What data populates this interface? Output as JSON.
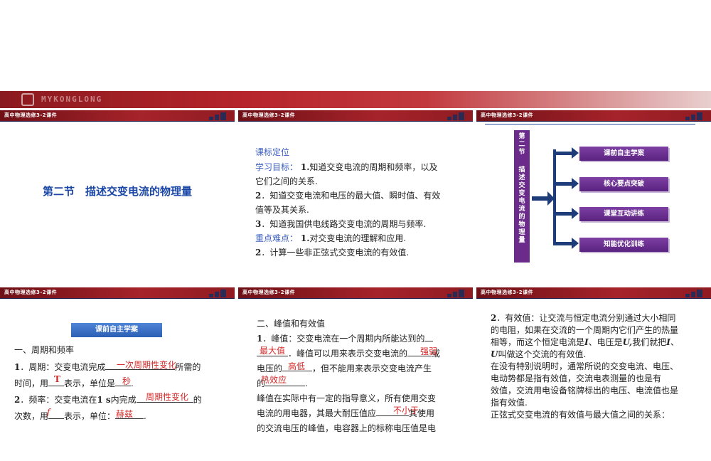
{
  "brand": "MYKONGLONG",
  "header": "高中物理选修3-2课件",
  "slide1": {
    "title": "第二节　描述交变电流的物理量"
  },
  "slide2": {
    "heading": "课标定位",
    "goal_label": "学习目标：",
    "g1a": "1.",
    "g1b": "知道交变电流的周期和频率，以及",
    "g1c": "它们之间的关系.",
    "g2a": "2",
    "g2b": "．知道交变电流和电压的最大值、瞬时值、有效",
    "g2c": "值等及其关系.",
    "g3a": "3",
    "g3b": "．知道我国供电线路交变电流的周期与频率.",
    "key_label": "重点难点：",
    "k1a": "1.",
    "k1b": "对交变电流的理解和应用.",
    "k2a": "2",
    "k2b": "．计算一些非正弦式交变电流的有效值."
  },
  "slide3": {
    "vertical_title": "第二节描述交变电流的物理量",
    "menu": [
      "课前自主学案",
      "核心要点突破",
      "课堂互动讲练",
      "知能优化训练"
    ]
  },
  "slide4": {
    "section": "课前自主学案",
    "h1": "一、周期和频率",
    "l1a": "1",
    "l1b": "．周期：交变电流完成",
    "l1fill": "一次周期性变化",
    "l1c": "所需的",
    "l2a": "时间，用",
    "l2fill": "T",
    "l2b": "表示，单位是",
    "l2fill2": "秒",
    "l2c": ".",
    "l3a": "2",
    "l3b": "．频率：交变电流在",
    "l3s": "1 s",
    "l3c": "内完成",
    "l3fill": "周期性变化",
    "l3d": "的",
    "l4a": "次数，用",
    "l4fill": "f",
    "l4b": "表示，单位：",
    "l4fill2": "赫兹",
    "l4c": "."
  },
  "slide5": {
    "h2": "二、峰值和有效值",
    "p1a": "1",
    "p1b": "．峰值：交变电流在一个周期内所能达到的",
    "p1fill": "最大值",
    "p1c": "．峰值可以用来表示交变电流的",
    "p1fill2": "强弱",
    "p1d": "或",
    "p2a": "电压的",
    "p2fill": "高低",
    "p2b": "，但不能用来表示交变电流产生",
    "p3a": "的",
    "p3fill": "热效应",
    "p3b": ".",
    "p4": "峰值在实际中有一定的指导意义，所有使用交变",
    "p5a": "电流的用电器，其最大耐压值应",
    "p5fill": "不小于",
    "p5b": "其使用",
    "p6": "的交流电压的峰值，电容器上的标称电压值是电"
  },
  "slide6": {
    "r1a": "2",
    "r1b": "．有效值：让交流与恒定电流分别通过大小相同",
    "r2": "的电阻，如果在交流的一个周期内它们产生的热量",
    "r3a": "相等，而这个恒定电流是",
    "r3I": "I",
    "r3b": "、电压是",
    "r3U": "U,",
    "r3c": "我们就把",
    "r3I2": "I",
    "r3d": "、",
    "r4U": "U",
    "r4": "叫做这个交流的有效值.",
    "r5": "在没有特别说明时，通常所说的交变电流、电压、",
    "r6": "电动势都是指有效值，交流电表测量的也是有",
    "r7": "效值，交流用电设备铭牌标出的电压、电流值也是",
    "r8": "指有效值.",
    "r9": "正弦式交变电流的有效值与最大值之间的关系："
  }
}
